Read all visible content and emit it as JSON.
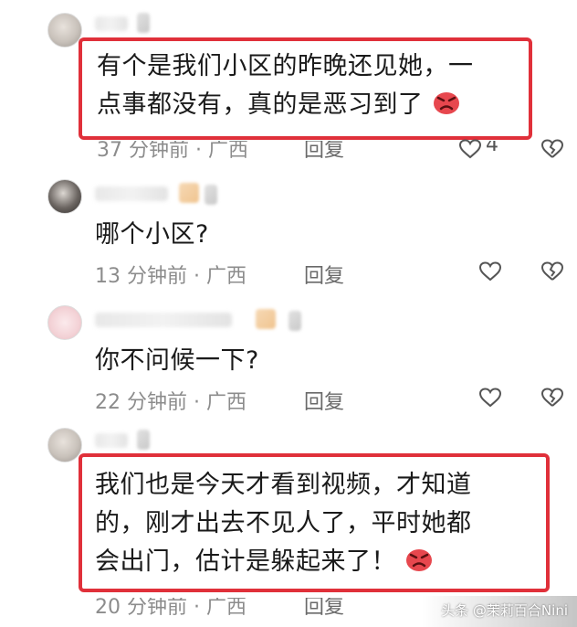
{
  "comments": [
    {
      "text_line1": "有个是我们小区的昨晚还见她，一",
      "text_line2": "点事都没有，真的是恶习到了",
      "time": "37 分钟前 · 广西",
      "reply_label": "回复",
      "like_count": "4"
    },
    {
      "text": "哪个小区?",
      "time": "13 分钟前 · 广西",
      "reply_label": "回复"
    },
    {
      "text": "你不问候一下?",
      "time": "22 分钟前 · 广西",
      "reply_label": "回复"
    },
    {
      "text_line1": "我们也是今天才看到视频，才知道",
      "text_line2": "的，刚才出去不见人了，平时她都",
      "text_line3": "会出门，估计是躲起来了！",
      "time": "20 分钟前 · 广西",
      "reply_label": "回复"
    }
  ],
  "watermark": "头条 @茉莉百合Nini",
  "colors": {
    "highlight": "#e0303a",
    "meta_text": "#8c8c8c",
    "body_text": "#1a1a1a"
  }
}
